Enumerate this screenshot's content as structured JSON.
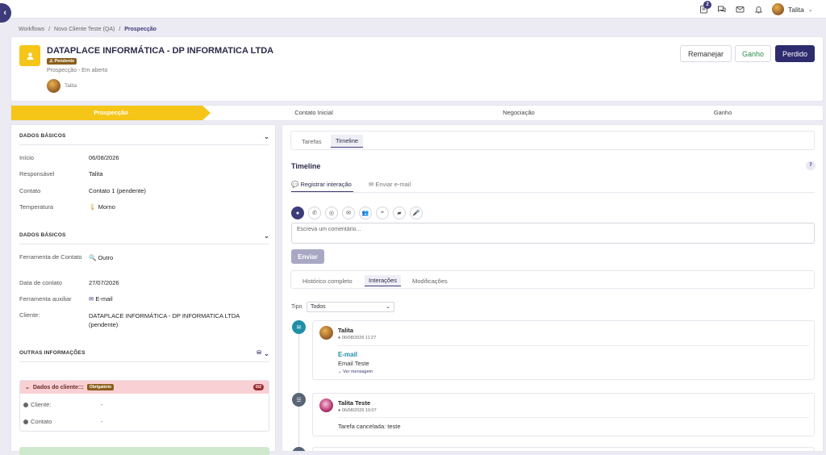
{
  "topbar": {
    "tasks_badge": "2",
    "user_name": "Talita",
    "icons": [
      "tasks-icon",
      "chat-icon",
      "mail-icon",
      "bell-icon"
    ]
  },
  "breadcrumb": {
    "items": [
      "Workflows",
      "Novo Cliente Teste (QA)"
    ],
    "current": "Prospecção",
    "separator": "/"
  },
  "header": {
    "title": "DATAPLACE INFORMÁTICA - DP INFORMATICA LTDA",
    "status_badge": "⚠ Pendente",
    "subtitle": "Prospecção - Em aberto",
    "owner": "Talita",
    "buttons": {
      "remanejar": "Remanejar",
      "ganho": "Ganho",
      "perdido": "Perdido"
    }
  },
  "steps": [
    "Prospecção",
    "Contato Inicial",
    "Negociação",
    "Ganho"
  ],
  "left": {
    "section1": {
      "title": "DADOS BÁSICOS",
      "fields": [
        {
          "label": "Início",
          "value": "06/08/2026"
        },
        {
          "label": "Responsável",
          "value": "Talita"
        },
        {
          "label": "Contato",
          "value": "Contato 1 (pendente)"
        },
        {
          "label": "Temperatura",
          "value": "Morno"
        }
      ]
    },
    "section2": {
      "title": "DADOS BÁSICOS",
      "fields": [
        {
          "label": "Ferramenta de Contato",
          "value": "Outro"
        },
        {
          "label": "Data de contato",
          "value": "27/07/2026"
        },
        {
          "label": "Ferramenta auxiliar",
          "value": "E-mail"
        },
        {
          "label": "Cliente:",
          "value": "DATAPLACE INFORMÁTICA - DP INFORMATICA LTDA (pendente)"
        }
      ]
    },
    "section3": {
      "title": "OUTRAS INFORMAÇÕES"
    },
    "client_box": {
      "title": "Dados do cliente:::",
      "badge": "Obrigatório",
      "count": "0/2",
      "rows": [
        {
          "label": "Cliente:",
          "value": "-"
        },
        {
          "label": "Contato",
          "value": "-"
        }
      ]
    }
  },
  "right": {
    "top_tabs": [
      "Tarefas",
      "Timeline"
    ],
    "timeline_title": "Timeline",
    "timeline_count": "7",
    "sub_tabs": [
      "Registrar interação",
      "Enviar e-mail"
    ],
    "comment_placeholder": "Escreva um comentário...",
    "send_label": "Enviar",
    "filter_tabs": [
      "Histórico completo",
      "Interações",
      "Modificações"
    ],
    "tipo_label": "Tipo",
    "tipo_value": "Todos",
    "entries": [
      {
        "author": "Talita",
        "time": "06/08/2026 11:27",
        "type": "E-mail",
        "text": "Email Teste",
        "link": "Ver mensagem"
      },
      {
        "author": "Talita Teste",
        "time": "06/08/2026 10:07",
        "text": "Tarefa cancelada: teste"
      }
    ]
  },
  "colors": {
    "accent": "#3d3b7a",
    "yellow": "#f5c518",
    "teal": "#1e8fa8",
    "slate": "#5a6478"
  }
}
